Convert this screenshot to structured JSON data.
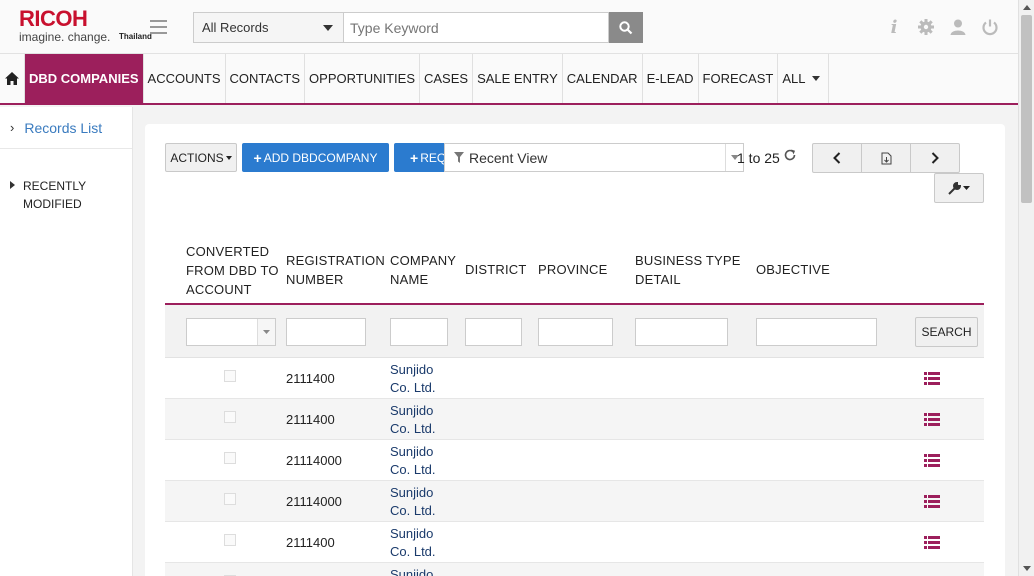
{
  "brand": {
    "name": "RICOH",
    "tagline": "imagine. change.",
    "country": "Thailand",
    "color": "#c8102e"
  },
  "search": {
    "scope": "All Records",
    "placeholder": "Type Keyword"
  },
  "top_icons": [
    "info-icon",
    "gear-icon",
    "user-icon",
    "power-icon"
  ],
  "nav": {
    "items": [
      {
        "label": "DBD COMPANIES",
        "active": true
      },
      {
        "label": "ACCOUNTS"
      },
      {
        "label": "CONTACTS"
      },
      {
        "label": "OPPORTUNITIES"
      },
      {
        "label": "CASES"
      },
      {
        "label": "SALE ENTRY"
      },
      {
        "label": "CALENDAR"
      },
      {
        "label": "E-LEAD"
      },
      {
        "label": "FORECAST"
      },
      {
        "label": "ALL"
      }
    ],
    "accent": "#9c1f5c"
  },
  "sidebar": {
    "records_list": "Records List",
    "recent_line1": "RECENTLY",
    "recent_line2": "MODIFIED"
  },
  "toolbar": {
    "actions": "ACTIONS",
    "add": "ADD DBDCOMPANY",
    "req": "REQ",
    "view": "Recent View",
    "page_info": "1 to 25"
  },
  "table": {
    "headers": {
      "converted_1": "CONVERTED",
      "converted_2": "FROM DBD TO",
      "converted_3": "ACCOUNT",
      "reg_1": "REGISTRATION",
      "reg_2": "NUMBER",
      "company_1": "COMPANY",
      "company_2": "NAME",
      "district": "DISTRICT",
      "province": "PROVINCE",
      "business_1": "BUSINESS TYPE",
      "business_2": "DETAIL",
      "objective": "OBJECTIVE"
    },
    "search_button": "SEARCH",
    "rows": [
      {
        "reg": "2111400",
        "company_1": "Sunjido",
        "company_2": "Co. Ltd."
      },
      {
        "reg": "2111400",
        "company_1": "Sunjido",
        "company_2": "Co. Ltd."
      },
      {
        "reg": "21114000",
        "company_1": "Sunjido",
        "company_2": "Co. Ltd."
      },
      {
        "reg": "21114000",
        "company_1": "Sunjido",
        "company_2": "Co. Ltd."
      },
      {
        "reg": "2111400",
        "company_1": "Sunjido",
        "company_2": "Co. Ltd."
      },
      {
        "reg": "",
        "company_1": "Sunjido",
        "company_2": ""
      }
    ]
  }
}
